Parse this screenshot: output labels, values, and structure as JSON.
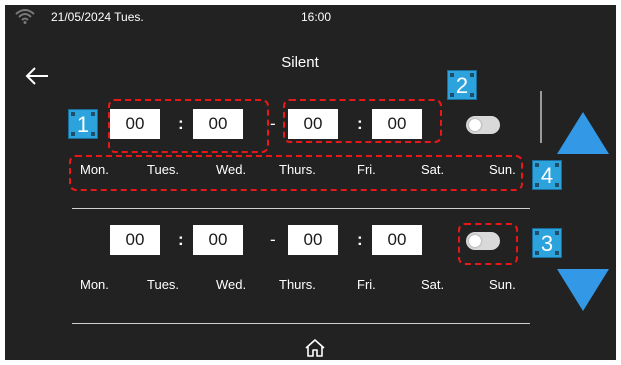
{
  "status_bar": {
    "date": "21/05/2024 Tues.",
    "time": "16:00"
  },
  "header": {
    "title": "Silent"
  },
  "schedules": [
    {
      "start_hour": "00",
      "start_min": "00",
      "end_hour": "00",
      "end_min": "00",
      "separator": ":",
      "range_dash": "-",
      "enabled": false
    },
    {
      "start_hour": "00",
      "start_min": "00",
      "end_hour": "00",
      "end_min": "00",
      "separator": ":",
      "range_dash": "-",
      "enabled": false
    }
  ],
  "days": [
    "Mon.",
    "Tues.",
    "Wed.",
    "Thurs.",
    "Fri.",
    "Sat.",
    "Sun."
  ],
  "callouts": [
    "1",
    "2",
    "3",
    "4"
  ],
  "colors": {
    "background": "#222222",
    "accent_blue": "#3399e6",
    "callout_blue": "#2da3dd",
    "highlight_red": "#e81818",
    "toggle_off": "#d9d9d9"
  },
  "icons": {
    "wifi": "wifi-icon",
    "back": "back-arrow-icon",
    "up": "scroll-up-icon",
    "down": "scroll-down-icon",
    "home": "home-icon"
  }
}
